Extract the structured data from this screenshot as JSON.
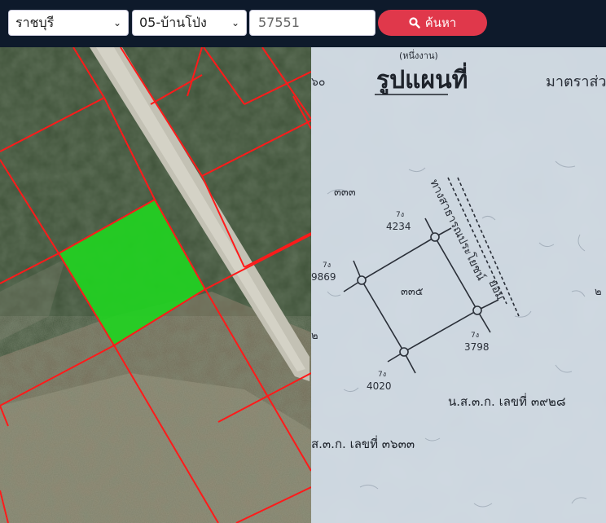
{
  "search": {
    "province": "ราชบุรี",
    "district": "05-บ้านโป่ง",
    "parcel_number": "57551",
    "search_label": "ค้นหา"
  },
  "map_document": {
    "heading": "รูปแผนที่",
    "subheading": "(หนึ่งงาน)",
    "scale_label": "มาตราส่ว",
    "left_margin_text": "๖๐",
    "parcel_number_left": "๓๓๓",
    "parcel_number_center": "๓๓๕",
    "road_text": "ทางสาธารณประโยชน์",
    "road_text_2": "ยอม",
    "marker_top_code": "7ง",
    "marker_top_value": "4234",
    "marker_left_code": "7ง",
    "marker_left_value": "9869",
    "marker_right_code": "7ง",
    "marker_right_value": "3798",
    "marker_bottom_code": "7ง",
    "marker_bottom_value": "4020",
    "side_mark": "๒",
    "side_mark_2": "๒",
    "deed_ref_1": "น.ส.๓.ก. เลขที่ ๓๙๒๘",
    "deed_ref_2": "ส.๓.ก. เลขที่ ๓๖๓๓"
  },
  "colors": {
    "header_bg": "#0e1a2b",
    "button_bg": "#e0384b",
    "parcel_highlight": "#22dd22",
    "boundary": "#ff1a1a"
  }
}
